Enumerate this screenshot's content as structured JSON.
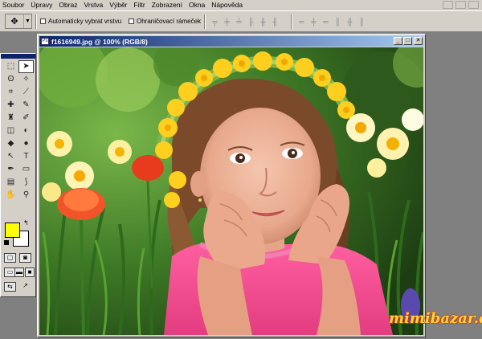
{
  "menu": [
    "Soubor",
    "Úpravy",
    "Obraz",
    "Vrstva",
    "Výběr",
    "Filtr",
    "Zobrazení",
    "Okna",
    "Nápověda"
  ],
  "options": {
    "auto_select_label": "Automaticky vybrat vrstvu",
    "bounding_box_label": "Ohraničovací rámeček"
  },
  "colors": {
    "foreground": "#ffff00",
    "background": "#ffffff"
  },
  "document": {
    "title": "f1616949.jpg @ 100% (RGB/8)"
  },
  "watermark": "mimibazar.cz"
}
